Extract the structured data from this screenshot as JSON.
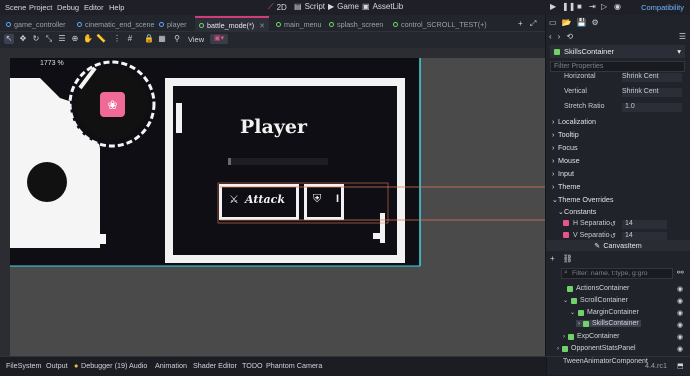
{
  "menu": {
    "scene": "Scene",
    "project": "Project",
    "debug": "Debug",
    "editor": "Editor",
    "help": "Help"
  },
  "workspaces": {
    "w2d": "2D",
    "script": "Script",
    "game": "Game",
    "assetlib": "AssetLib"
  },
  "renderer": "Compatibility",
  "tabs": [
    "game_controller",
    "cinematic_end_scene",
    "player",
    "battle_mode(*)",
    "main_menu",
    "splash_screen",
    "control_SCROLL_TEST(+)"
  ],
  "toolbar": {
    "view_label": "View"
  },
  "viewport": {
    "zoom": "1773 %",
    "player_title": "Player",
    "attack_label": "Attack"
  },
  "inspector": {
    "node_name": "SkillsContainer",
    "filter_placeholder": "Filter Properties",
    "horizontal_label": "Horizontal",
    "horizontal_value": "Shrink Cent",
    "vertical_label": "Vertical",
    "vertical_value": "Shrink Cent",
    "stretch_label": "Stretch Ratio",
    "stretch_value": "1.0",
    "sections": [
      "Localization",
      "Tooltip",
      "Focus",
      "Mouse",
      "Input",
      "Theme",
      "Theme Overrides"
    ],
    "constants_label": "Constants",
    "hsep_label": "H Separatio",
    "hsep_value": "14",
    "vsep_label": "V Separatio",
    "vsep_value": "14",
    "canvasitem_label": "CanvasItem"
  },
  "scene_tree": {
    "filter_placeholder": "Filter: name, t:type, g:gro",
    "items": [
      "ActionsContainer",
      "ScrollContainer",
      "MarginContainer",
      "SkillsContainer",
      "ExpContainer",
      "OpponentStatsPanel",
      "TweenAnimatorComponent"
    ]
  },
  "bottom": {
    "filesystem": "FileSystem",
    "output": "Output",
    "debugger": "Debugger (19)",
    "audio": "Audio",
    "animation": "Animation",
    "shader": "Shader Editor",
    "todo": "TODO",
    "phantom": "Phantom Camera",
    "version": "4.4.rc1"
  },
  "colors": {
    "accent": "#cf3e7a",
    "link": "#5aa8ff",
    "node_green": "#6fd36a"
  }
}
